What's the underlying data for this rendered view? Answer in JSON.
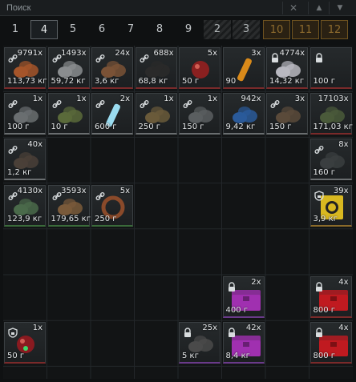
{
  "search": {
    "placeholder": "Поиск"
  },
  "tabs": [
    {
      "label": "1",
      "state": "normal"
    },
    {
      "label": "4",
      "state": "active"
    },
    {
      "label": "5",
      "state": "normal"
    },
    {
      "label": "6",
      "state": "normal"
    },
    {
      "label": "7",
      "state": "normal"
    },
    {
      "label": "8",
      "state": "normal"
    },
    {
      "label": "9",
      "state": "normal"
    },
    {
      "label": "2",
      "state": "locked"
    },
    {
      "label": "3",
      "state": "locked"
    },
    {
      "label": "10",
      "state": "gold"
    },
    {
      "label": "11",
      "state": "gold"
    },
    {
      "label": "12",
      "state": "gold"
    }
  ],
  "items": [
    {
      "row": 0,
      "col": 0,
      "count": "9791x",
      "weight": "113,73 кг",
      "icon": "ore-pile-icon",
      "color": "#a5552a",
      "rarity": "red",
      "lock": "link"
    },
    {
      "row": 0,
      "col": 1,
      "count": "1493x",
      "weight": "59,72 кг",
      "icon": "stones-icon",
      "color": "#8a8d8f",
      "rarity": "red",
      "lock": "link"
    },
    {
      "row": 0,
      "col": 2,
      "count": "24x",
      "weight": "3,6 кг",
      "icon": "wood-logs-icon",
      "color": "#7a5236",
      "rarity": "red",
      "lock": "link"
    },
    {
      "row": 0,
      "col": 3,
      "count": "688x",
      "weight": "68,8 кг",
      "icon": "coal-icon",
      "color": "#2a2a2a",
      "rarity": "red",
      "lock": "link"
    },
    {
      "row": 0,
      "col": 4,
      "count": "5x",
      "weight": "50 г",
      "icon": "red-orb-icon",
      "color": "#8a2020",
      "rarity": "red",
      "lock": "none"
    },
    {
      "row": 0,
      "col": 5,
      "count": "3x",
      "weight": "90",
      "icon": "potion-vial-icon",
      "color": "#d98a1a",
      "rarity": "red",
      "lock": "none"
    },
    {
      "row": 0,
      "col": 6,
      "count": "4774x",
      "weight": "14,32 кг",
      "icon": "crystal-chunk-icon",
      "color": "#b8b8c0",
      "rarity": "red",
      "lock": "padlock"
    },
    {
      "row": 0,
      "col": 7,
      "count": "",
      "weight": "100 г",
      "icon": "empty-slot-icon",
      "color": "#303436",
      "rarity": "red",
      "lock": "padlock"
    },
    {
      "row": 1,
      "col": 0,
      "count": "1x",
      "weight": "100 г",
      "icon": "flask-icon",
      "color": "#6a6e70",
      "rarity": "grey",
      "lock": "link"
    },
    {
      "row": 1,
      "col": 1,
      "count": "1x",
      "weight": "10 г",
      "icon": "leaf-icon",
      "color": "#5a6a3a",
      "rarity": "grey",
      "lock": "link"
    },
    {
      "row": 1,
      "col": 2,
      "count": "2x",
      "weight": "600 г",
      "icon": "glow-tube-icon",
      "color": "#9adcf0",
      "rarity": "grey",
      "lock": "link"
    },
    {
      "row": 1,
      "col": 3,
      "count": "1x",
      "weight": "250 г",
      "icon": "crate-icon",
      "color": "#6a5a3a",
      "rarity": "grey",
      "lock": "link"
    },
    {
      "row": 1,
      "col": 4,
      "count": "1x",
      "weight": "150 г",
      "icon": "case-icon",
      "color": "#5a5e60",
      "rarity": "grey",
      "lock": "link"
    },
    {
      "row": 1,
      "col": 5,
      "count": "942x",
      "weight": "9,42 кг",
      "icon": "blue-granules-icon",
      "color": "#2a5a9a",
      "rarity": "grey",
      "lock": "none"
    },
    {
      "row": 1,
      "col": 6,
      "count": "3x",
      "weight": "150 г",
      "icon": "scrap-metal-icon",
      "color": "#5a4a3a",
      "rarity": "grey",
      "lock": "link"
    },
    {
      "row": 1,
      "col": 7,
      "count": "17103x",
      "weight": "171,03 кг",
      "icon": "sacks-icon",
      "color": "#4a5a3a",
      "rarity": "red",
      "lock": "none"
    },
    {
      "row": 2,
      "col": 0,
      "count": "40x",
      "weight": "1,2 кг",
      "icon": "parts-icon",
      "color": "#4a4038",
      "rarity": "grey",
      "lock": "link"
    },
    {
      "row": 2,
      "col": 7,
      "count": "8x",
      "weight": "160 г",
      "icon": "device-icon",
      "color": "#3a3e40",
      "rarity": "grey",
      "lock": "link"
    },
    {
      "row": 3,
      "col": 0,
      "count": "4130x",
      "weight": "123,9 кг",
      "icon": "green-ore-icon",
      "color": "#4a6a4a",
      "rarity": "green",
      "lock": "link"
    },
    {
      "row": 3,
      "col": 1,
      "count": "3593x",
      "weight": "179,65 кг",
      "icon": "brown-ore-icon",
      "color": "#7a5a3a",
      "rarity": "green",
      "lock": "link"
    },
    {
      "row": 3,
      "col": 2,
      "count": "5x",
      "weight": "250 г",
      "icon": "ring-coil-icon",
      "color": "#8a4a2a",
      "rarity": "green",
      "lock": "link"
    },
    {
      "row": 3,
      "col": 7,
      "count": "39x",
      "weight": "3,9 кг",
      "icon": "yellow-book-icon",
      "color": "#d8b820",
      "rarity": "gold",
      "lock": "shield"
    },
    {
      "row": 5,
      "col": 5,
      "count": "2x",
      "weight": "400 г",
      "icon": "purple-chest-icon",
      "color": "#a030b0",
      "rarity": "purple",
      "lock": "padlock"
    },
    {
      "row": 5,
      "col": 7,
      "count": "4x",
      "weight": "800 г",
      "icon": "red-chest-icon",
      "color": "#c01a20",
      "rarity": "red",
      "lock": "padlock"
    },
    {
      "row": 6,
      "col": 0,
      "count": "1x",
      "weight": "50 г",
      "icon": "red-gem-icon",
      "color": "#8a1a20",
      "rarity": "red",
      "lock": "shield"
    },
    {
      "row": 6,
      "col": 4,
      "count": "25x",
      "weight": "5 кг",
      "icon": "weapon-case-icon",
      "color": "#4a4a4a",
      "rarity": "purple",
      "lock": "padlock"
    },
    {
      "row": 6,
      "col": 5,
      "count": "42x",
      "weight": "8,4 кг",
      "icon": "purple-chest-icon",
      "color": "#a030b0",
      "rarity": "purple",
      "lock": "padlock"
    },
    {
      "row": 6,
      "col": 7,
      "count": "4x",
      "weight": "800 г",
      "icon": "red-chest-icon",
      "color": "#c01a20",
      "rarity": "red",
      "lock": "padlock"
    }
  ]
}
